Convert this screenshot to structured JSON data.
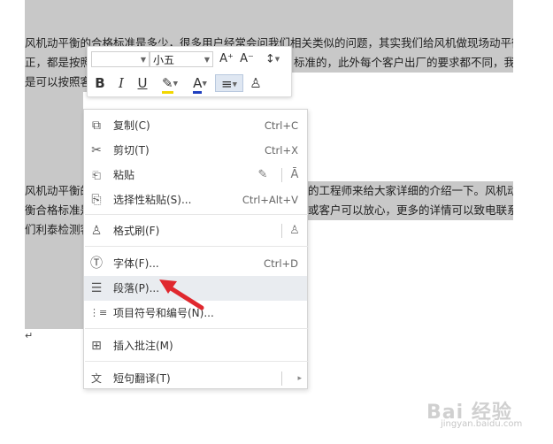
{
  "document": {
    "lines": [
      "风机动平衡的合格标准是多少，很多用户经常会问我们相关类似的问题，其实我们给风机做现场动平衡校",
      "正，都是按照",
      "标准的，此外每个客户出厂的要求都不同，我们都",
      "是可以按照客",
      "风机动平衡的",
      "的工程师来给大家详细的介绍一下。风机动平",
      "衡合格标准是",
      "或客户可以放心，更多的详情可以致电联系我",
      "们利泰检测客"
    ],
    "paragraph_mark": "↵"
  },
  "mini_toolbar": {
    "font_name": "",
    "font_size": "小五",
    "grow_font": "A⁺",
    "shrink_font": "A⁻",
    "line_spacing": "↕",
    "bold": "B",
    "italic": "I",
    "underline": "U",
    "highlight": "✎",
    "font_color": "A",
    "align": "≡",
    "format_painter": "♙",
    "highlight_color": "#f2d700",
    "font_color_value": "#1f3fbf"
  },
  "context_menu": {
    "items": [
      {
        "label": "复制(C)",
        "shortcut": "Ctrl+C",
        "icon": "copy-icon",
        "glyph": "⧉"
      },
      {
        "label": "剪切(T)",
        "shortcut": "Ctrl+X",
        "icon": "scissors-icon",
        "glyph": "✂"
      },
      {
        "label": "粘贴",
        "shortcut": "",
        "icon": "paste-icon",
        "glyph": "📋"
      },
      {
        "label": "选择性粘贴(S)...",
        "shortcut": "Ctrl+Alt+V",
        "icon": "paste-special-icon",
        "glyph": "⎘"
      },
      {
        "label": "格式刷(F)",
        "shortcut": "",
        "icon": "format-painter-icon",
        "glyph": "♙"
      },
      {
        "label": "字体(F)...",
        "shortcut": "Ctrl+D",
        "icon": "font-icon",
        "glyph": "Ⓣ"
      },
      {
        "label": "段落(P)...",
        "shortcut": "",
        "icon": "paragraph-icon",
        "glyph": "☰"
      },
      {
        "label": "项目符号和编号(N)...",
        "shortcut": "",
        "icon": "bullets-icon",
        "glyph": "⋮≡"
      },
      {
        "label": "插入批注(M)",
        "shortcut": "",
        "icon": "comment-icon",
        "glyph": "🗨"
      },
      {
        "label": "短句翻译(T)",
        "shortcut": "",
        "icon": "translate-icon",
        "glyph": "文"
      }
    ],
    "submenu_arrow": "▸"
  },
  "colors": {
    "selection": "#c8c8c8",
    "hover": "#e9ecf0",
    "arrow": "#e0282e"
  },
  "watermark": {
    "brand": "Bai 经验",
    "sub": "jingyan.baidu.com"
  }
}
